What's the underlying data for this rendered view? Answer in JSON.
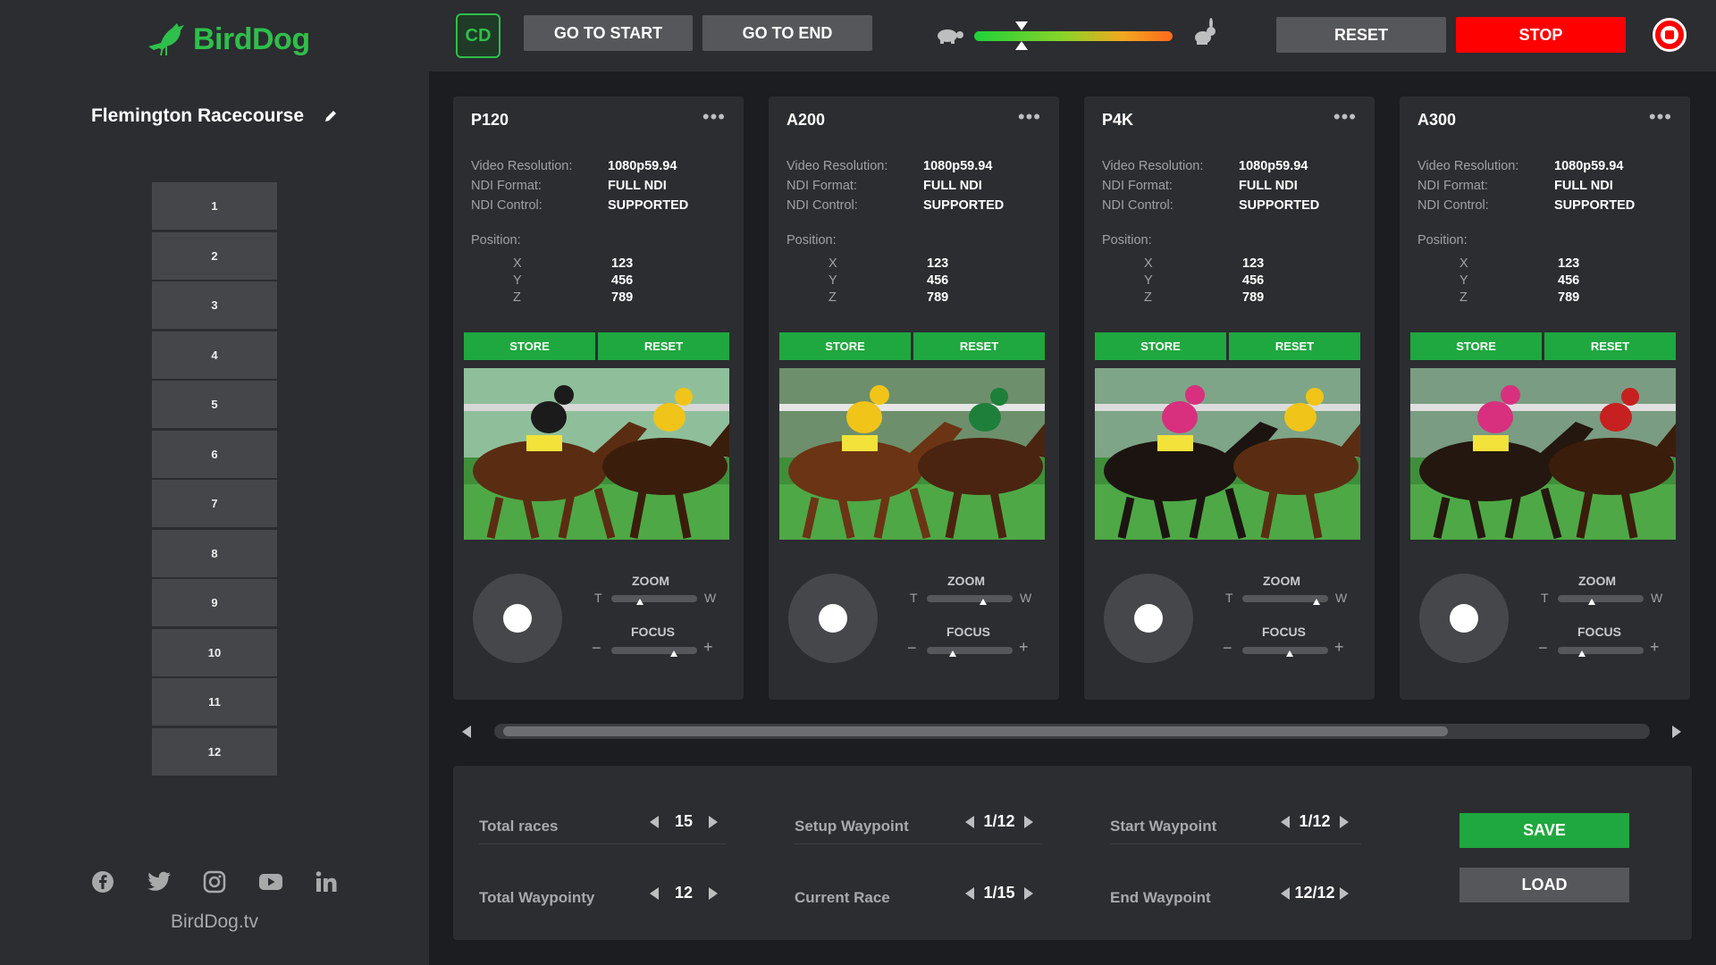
{
  "brand": {
    "logo_text": "BirdDog",
    "website": "BirdDog.tv",
    "accent": "#2fbf4b"
  },
  "sidebar": {
    "venue": "Flemington Racecourse",
    "slots": [
      "1",
      "2",
      "3",
      "4",
      "5",
      "6",
      "7",
      "8",
      "9",
      "10",
      "11",
      "12"
    ],
    "socials": [
      "facebook-icon",
      "twitter-icon",
      "instagram-icon",
      "youtube-icon",
      "linkedin-icon"
    ]
  },
  "topbar": {
    "badge": "CD",
    "go_to_start": "GO TO START",
    "go_to_end": "GO TO END",
    "speed_level": 0.24,
    "reset": "RESET",
    "stop": "STOP",
    "stop_color": "#ff0000"
  },
  "labels": {
    "video_resolution": "Video Resolution:",
    "ndi_format": "NDI Format:",
    "ndi_control": "NDI Control:",
    "position": "Position:",
    "x": "X",
    "y": "Y",
    "z": "Z",
    "store": "STORE",
    "reset": "RESET",
    "zoom": "ZOOM",
    "focus": "FOCUS",
    "tele": "T",
    "wide": "W",
    "minus": "−",
    "plus": "+"
  },
  "cameras": [
    {
      "name": "P120",
      "resolution": "1080p59.94",
      "format": "FULL NDI",
      "control": "SUPPORTED",
      "x": "123",
      "y": "456",
      "z": "789",
      "zoom": 0.25,
      "focus": 0.7
    },
    {
      "name": "A200",
      "resolution": "1080p59.94",
      "format": "FULL NDI",
      "control": "SUPPORTED",
      "x": "123",
      "y": "456",
      "z": "789",
      "zoom": 0.62,
      "focus": 0.22
    },
    {
      "name": "P4K",
      "resolution": "1080p59.94",
      "format": "FULL NDI",
      "control": "SUPPORTED",
      "x": "123",
      "y": "456",
      "z": "789",
      "zoom": 0.85,
      "focus": 0.5
    },
    {
      "name": "A300",
      "resolution": "1080p59.94",
      "format": "FULL NDI",
      "control": "SUPPORTED",
      "x": "123",
      "y": "456",
      "z": "789",
      "zoom": 0.32,
      "focus": 0.2
    }
  ],
  "scroll": {
    "position": 0.0,
    "visible_fraction": 0.83
  },
  "bottom": {
    "total_races": {
      "label": "Total races",
      "value": "15"
    },
    "total_waypoints": {
      "label": "Total Waypointy",
      "value": "12"
    },
    "setup_waypoint": {
      "label": "Setup Waypoint",
      "value": "1/12"
    },
    "current_race": {
      "label": "Current Race",
      "value": "1/15"
    },
    "start_waypoint": {
      "label": "Start Waypoint",
      "value": "1/12"
    },
    "end_waypoint": {
      "label": "End Waypoint",
      "value": "12/12"
    },
    "save": "SAVE",
    "load": "LOAD"
  }
}
